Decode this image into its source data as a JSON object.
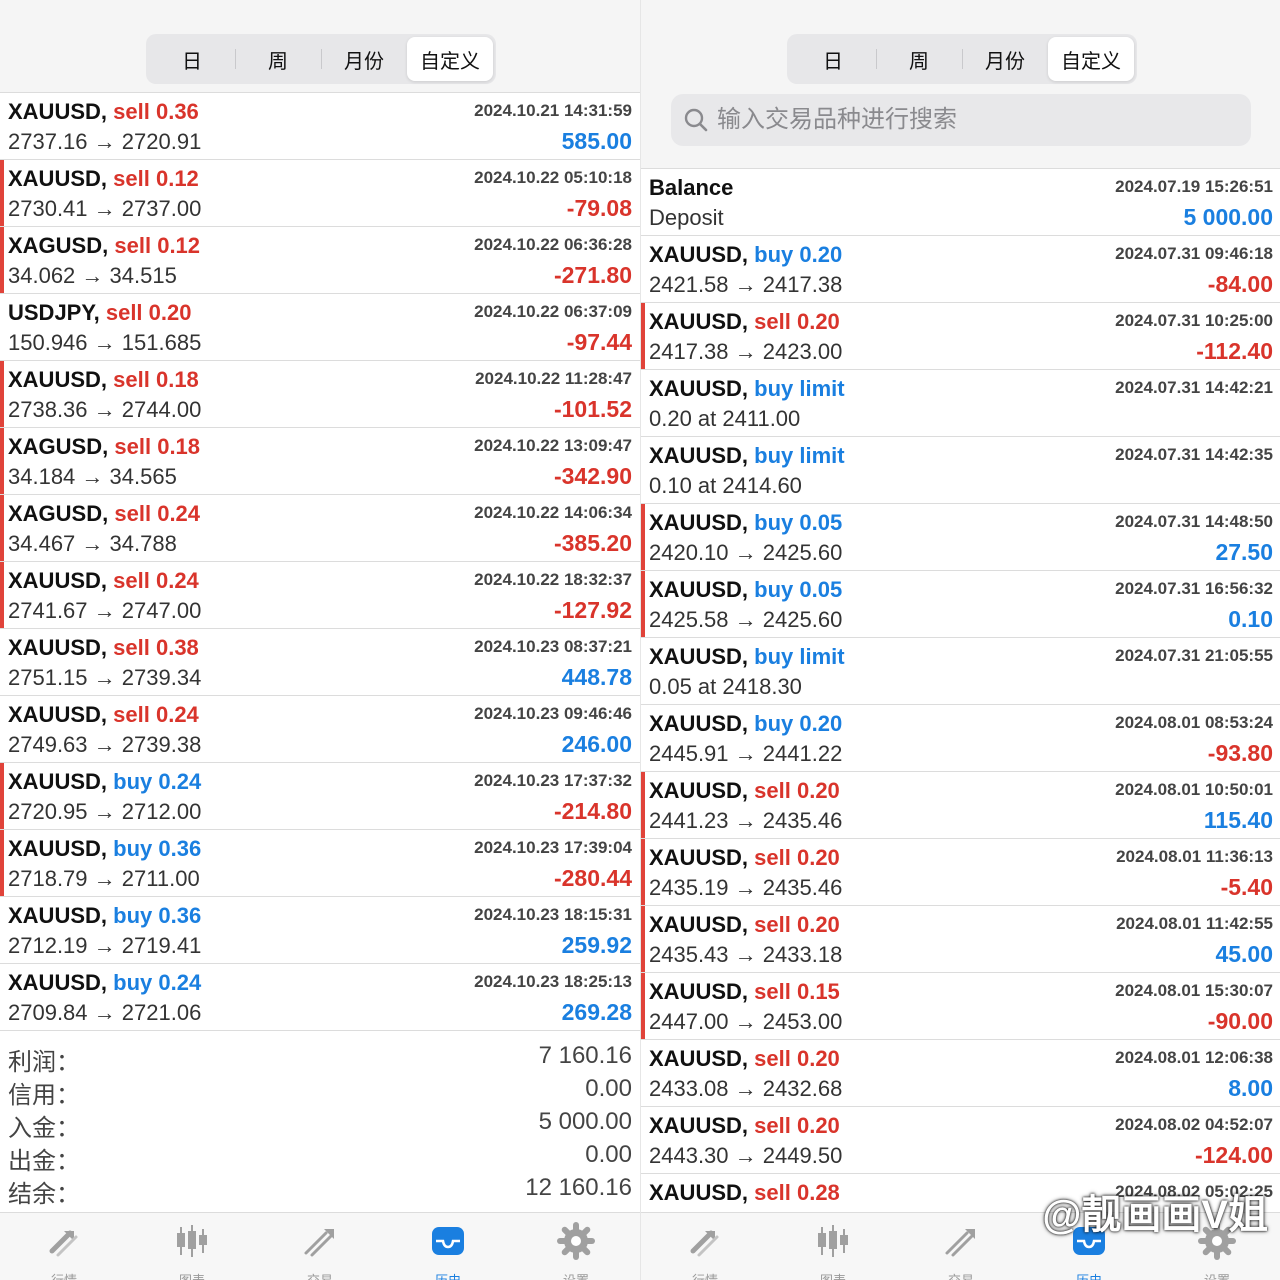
{
  "left": {
    "segments": [
      "日",
      "周",
      "月份",
      "自定义"
    ],
    "active_segment": 3,
    "rows": [
      {
        "symbol": "XAUUSD,",
        "side": "sell",
        "lot": "0.36",
        "from": "2737.16",
        "arrow": "→",
        "to": "2720.91",
        "time": "2024.10.21 14:31:59",
        "pl": "585.00",
        "sign": "pos",
        "marked": false
      },
      {
        "symbol": "XAUUSD,",
        "side": "sell",
        "lot": "0.12",
        "from": "2730.41",
        "arrow": "→",
        "to": "2737.00",
        "time": "2024.10.22 05:10:18",
        "pl": "-79.08",
        "sign": "neg",
        "marked": true
      },
      {
        "symbol": "XAGUSD,",
        "side": "sell",
        "lot": "0.12",
        "from": "34.062",
        "arrow": "→",
        "to": "34.515",
        "time": "2024.10.22 06:36:28",
        "pl": "-271.80",
        "sign": "neg",
        "marked": true
      },
      {
        "symbol": "USDJPY,",
        "side": "sell",
        "lot": "0.20",
        "from": "150.946",
        "arrow": "→",
        "to": "151.685",
        "time": "2024.10.22 06:37:09",
        "pl": "-97.44",
        "sign": "neg",
        "marked": false
      },
      {
        "symbol": "XAUUSD,",
        "side": "sell",
        "lot": "0.18",
        "from": "2738.36",
        "arrow": "→",
        "to": "2744.00",
        "time": "2024.10.22 11:28:47",
        "pl": "-101.52",
        "sign": "neg",
        "marked": true
      },
      {
        "symbol": "XAGUSD,",
        "side": "sell",
        "lot": "0.18",
        "from": "34.184",
        "arrow": "→",
        "to": "34.565",
        "time": "2024.10.22 13:09:47",
        "pl": "-342.90",
        "sign": "neg",
        "marked": true
      },
      {
        "symbol": "XAGUSD,",
        "side": "sell",
        "lot": "0.24",
        "from": "34.467",
        "arrow": "→",
        "to": "34.788",
        "time": "2024.10.22 14:06:34",
        "pl": "-385.20",
        "sign": "neg",
        "marked": true
      },
      {
        "symbol": "XAUUSD,",
        "side": "sell",
        "lot": "0.24",
        "from": "2741.67",
        "arrow": "→",
        "to": "2747.00",
        "time": "2024.10.22 18:32:37",
        "pl": "-127.92",
        "sign": "neg",
        "marked": true
      },
      {
        "symbol": "XAUUSD,",
        "side": "sell",
        "lot": "0.38",
        "from": "2751.15",
        "arrow": "→",
        "to": "2739.34",
        "time": "2024.10.23 08:37:21",
        "pl": "448.78",
        "sign": "pos",
        "marked": false
      },
      {
        "symbol": "XAUUSD,",
        "side": "sell",
        "lot": "0.24",
        "from": "2749.63",
        "arrow": "→",
        "to": "2739.38",
        "time": "2024.10.23 09:46:46",
        "pl": "246.00",
        "sign": "pos",
        "marked": false
      },
      {
        "symbol": "XAUUSD,",
        "side": "buy",
        "lot": "0.24",
        "from": "2720.95",
        "arrow": "→",
        "to": "2712.00",
        "time": "2024.10.23 17:37:32",
        "pl": "-214.80",
        "sign": "neg",
        "marked": true
      },
      {
        "symbol": "XAUUSD,",
        "side": "buy",
        "lot": "0.36",
        "from": "2718.79",
        "arrow": "→",
        "to": "2711.00",
        "time": "2024.10.23 17:39:04",
        "pl": "-280.44",
        "sign": "neg",
        "marked": true
      },
      {
        "symbol": "XAUUSD,",
        "side": "buy",
        "lot": "0.36",
        "from": "2712.19",
        "arrow": "→",
        "to": "2719.41",
        "time": "2024.10.23 18:15:31",
        "pl": "259.92",
        "sign": "pos",
        "marked": false
      },
      {
        "symbol": "XAUUSD,",
        "side": "buy",
        "lot": "0.24",
        "from": "2709.84",
        "arrow": "→",
        "to": "2721.06",
        "time": "2024.10.23 18:25:13",
        "pl": "269.28",
        "sign": "pos",
        "marked": false
      }
    ],
    "summary": [
      {
        "label": "利润：",
        "value": "7 160.16"
      },
      {
        "label": "信用：",
        "value": "0.00"
      },
      {
        "label": "入金：",
        "value": "5 000.00"
      },
      {
        "label": "出金：",
        "value": "0.00"
      },
      {
        "label": "结余：",
        "value": "12 160.16"
      }
    ]
  },
  "right": {
    "segments": [
      "日",
      "周",
      "月份",
      "自定义"
    ],
    "active_segment": 3,
    "search_placeholder": "输入交易品种进行搜索",
    "balance_row": {
      "title": "Balance",
      "subtitle": "Deposit",
      "time": "2024.07.19 15:26:51",
      "amount": "5 000.00"
    },
    "rows": [
      {
        "symbol": "XAUUSD,",
        "side": "buy",
        "lot": "0.20",
        "from": "2421.58",
        "arrow": "→",
        "to": "2417.38",
        "time": "2024.07.31 09:46:18",
        "pl": "-84.00",
        "sign": "neg",
        "marked": false
      },
      {
        "symbol": "XAUUSD,",
        "side": "sell",
        "lot": "0.20",
        "from": "2417.38",
        "arrow": "→",
        "to": "2423.00",
        "time": "2024.07.31 10:25:00",
        "pl": "-112.40",
        "sign": "neg",
        "marked": true
      },
      {
        "symbol": "XAUUSD,",
        "side": "buy limit",
        "lot": "",
        "from": "0.20 at 2411.00",
        "arrow": "",
        "to": "",
        "time": "2024.07.31 14:42:21",
        "pl": "",
        "sign": "pos",
        "marked": false
      },
      {
        "symbol": "XAUUSD,",
        "side": "buy limit",
        "lot": "",
        "from": "0.10 at 2414.60",
        "arrow": "",
        "to": "",
        "time": "2024.07.31 14:42:35",
        "pl": "",
        "sign": "pos",
        "marked": false
      },
      {
        "symbol": "XAUUSD,",
        "side": "buy",
        "lot": "0.05",
        "from": "2420.10",
        "arrow": "→",
        "to": "2425.60",
        "time": "2024.07.31 14:48:50",
        "pl": "27.50",
        "sign": "pos",
        "marked": true
      },
      {
        "symbol": "XAUUSD,",
        "side": "buy",
        "lot": "0.05",
        "from": "2425.58",
        "arrow": "→",
        "to": "2425.60",
        "time": "2024.07.31 16:56:32",
        "pl": "0.10",
        "sign": "pos",
        "marked": true
      },
      {
        "symbol": "XAUUSD,",
        "side": "buy limit",
        "lot": "",
        "from": "0.05 at 2418.30",
        "arrow": "",
        "to": "",
        "time": "2024.07.31 21:05:55",
        "pl": "",
        "sign": "pos",
        "marked": false
      },
      {
        "symbol": "XAUUSD,",
        "side": "buy",
        "lot": "0.20",
        "from": "2445.91",
        "arrow": "→",
        "to": "2441.22",
        "time": "2024.08.01 08:53:24",
        "pl": "-93.80",
        "sign": "neg",
        "marked": false
      },
      {
        "symbol": "XAUUSD,",
        "side": "sell",
        "lot": "0.20",
        "from": "2441.23",
        "arrow": "→",
        "to": "2435.46",
        "time": "2024.08.01 10:50:01",
        "pl": "115.40",
        "sign": "pos",
        "marked": true
      },
      {
        "symbol": "XAUUSD,",
        "side": "sell",
        "lot": "0.20",
        "from": "2435.19",
        "arrow": "→",
        "to": "2435.46",
        "time": "2024.08.01 11:36:13",
        "pl": "-5.40",
        "sign": "neg",
        "marked": true
      },
      {
        "symbol": "XAUUSD,",
        "side": "sell",
        "lot": "0.20",
        "from": "2435.43",
        "arrow": "→",
        "to": "2433.18",
        "time": "2024.08.01 11:42:55",
        "pl": "45.00",
        "sign": "pos",
        "marked": true
      },
      {
        "symbol": "XAUUSD,",
        "side": "sell",
        "lot": "0.15",
        "from": "2447.00",
        "arrow": "→",
        "to": "2453.00",
        "time": "2024.08.01 15:30:07",
        "pl": "-90.00",
        "sign": "neg",
        "marked": true
      },
      {
        "symbol": "XAUUSD,",
        "side": "sell",
        "lot": "0.20",
        "from": "2433.08",
        "arrow": "→",
        "to": "2432.68",
        "time": "2024.08.01 12:06:38",
        "pl": "8.00",
        "sign": "pos",
        "marked": false
      },
      {
        "symbol": "XAUUSD,",
        "side": "sell",
        "lot": "0.20",
        "from": "2443.30",
        "arrow": "→",
        "to": "2449.50",
        "time": "2024.08.02 04:52:07",
        "pl": "-124.00",
        "sign": "neg",
        "marked": false
      },
      {
        "symbol": "XAUUSD,",
        "side": "sell",
        "lot": "0.28",
        "from": "",
        "arrow": "",
        "to": "",
        "time": "2024.08.02 05:02:25",
        "pl": "",
        "sign": "pos",
        "marked": false
      }
    ]
  },
  "tabs": [
    {
      "label": "行情",
      "icon": "quotes-arrows-icon"
    },
    {
      "label": "图表",
      "icon": "candlestick-chart-icon"
    },
    {
      "label": "交易",
      "icon": "trade-trend-icon"
    },
    {
      "label": "历史",
      "icon": "history-inbox-icon"
    },
    {
      "label": "设置",
      "icon": "settings-gear-icon"
    }
  ],
  "active_tab": 3,
  "watermark": "@靓画画V姐",
  "colors": {
    "sell": "#d9342b",
    "buy": "#1a7fe0",
    "profit": "#1a7fe0",
    "loss": "#d9342b",
    "marker": "#e0433a",
    "tab_active": "#1a7fe0",
    "tab_inactive": "#9a9a9a"
  }
}
